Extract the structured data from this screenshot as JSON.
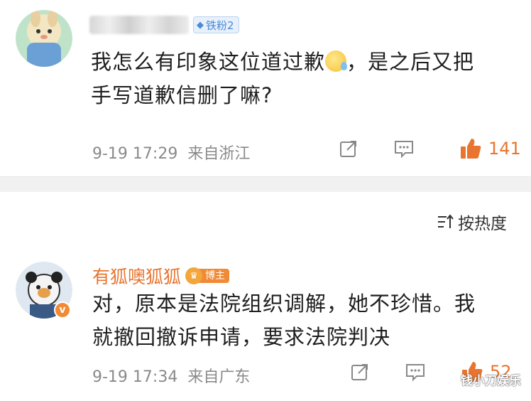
{
  "comments": [
    {
      "username": "",
      "badge": "铁粉2",
      "text_line1": "我怎么有印象这位道过歉",
      "text_line1_after": "，是之后又把",
      "text_line2": "手写道歉信删了嘛?",
      "time": "9-19 17:29",
      "location": "来自浙江",
      "likes": "141"
    },
    {
      "username": "有狐噢狐狐",
      "badge": "博主",
      "text_line1": "对，原本是法院组织调解，她不珍惜。我",
      "text_line2": "就撤回撤诉申请，要求法院判决",
      "time": "9-19 17:34",
      "location": "来自广东",
      "likes": "52"
    }
  ],
  "sort": {
    "label": "按热度"
  },
  "watermark": "钱小刀娱乐",
  "colors": {
    "accent": "#e8742f",
    "meta": "#8a8a8a",
    "fan_badge": "#4a8ad6"
  },
  "icons": [
    "share-icon",
    "comment-icon",
    "like-icon",
    "sort-icon",
    "verified-icon"
  ]
}
